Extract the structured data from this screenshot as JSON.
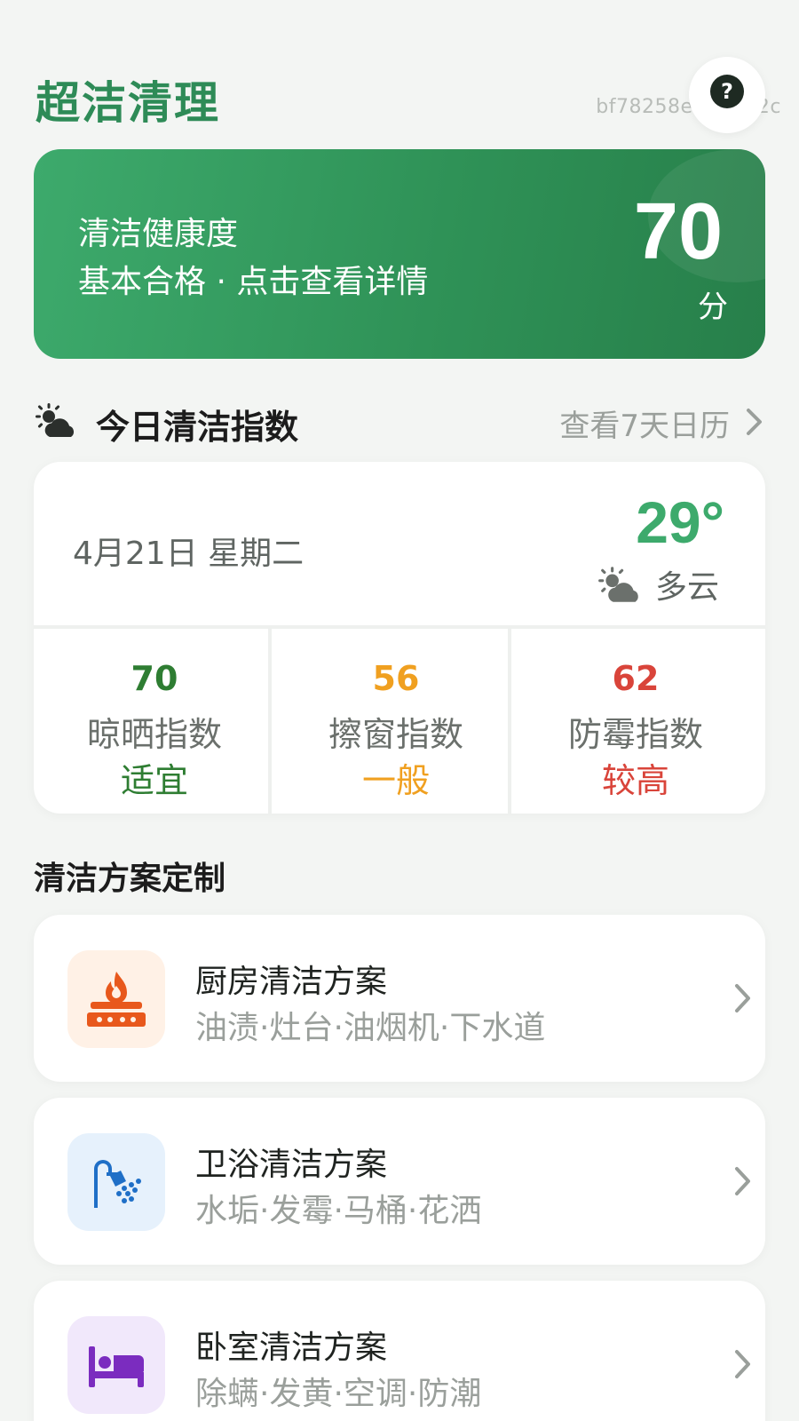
{
  "header": {
    "app_title": "超洁清理",
    "device_id": "bf78258e9dd312c",
    "help_label": "?"
  },
  "health": {
    "label": "清洁健康度",
    "subtitle": "基本合格 · 点击查看详情",
    "score": "70",
    "unit": "分"
  },
  "today": {
    "title": "今日清洁指数",
    "calendar_link": "查看7天日历",
    "date": "4月21日 星期二",
    "temperature": "29°",
    "condition": "多云",
    "indices": [
      {
        "value": "70",
        "name": "晾晒指数",
        "level": "适宜",
        "color": "#2e7d32"
      },
      {
        "value": "56",
        "name": "擦窗指数",
        "level": "一般",
        "color": "#f0a020"
      },
      {
        "value": "62",
        "name": "防霉指数",
        "level": "较高",
        "color": "#d9443a"
      }
    ]
  },
  "plans": {
    "title": "清洁方案定制",
    "items": [
      {
        "title": "厨房清洁方案",
        "subtitle": "油渍·灶台·油烟机·下水道",
        "icon": "stove-icon",
        "bg": "#fff1e6",
        "color": "#e8581c"
      },
      {
        "title": "卫浴清洁方案",
        "subtitle": "水垢·发霉·马桶·花洒",
        "icon": "shower-icon",
        "bg": "#e6f1fc",
        "color": "#1f6fc7"
      },
      {
        "title": "卧室清洁方案",
        "subtitle": "除螨·发黄·空调·防潮",
        "icon": "bed-icon",
        "bg": "#f1e8fb",
        "color": "#7b2cbf"
      }
    ]
  },
  "colors": {
    "brand_green": "#2e8b57",
    "banner_green": "#2f9257",
    "temp_green": "#3daa6c"
  }
}
